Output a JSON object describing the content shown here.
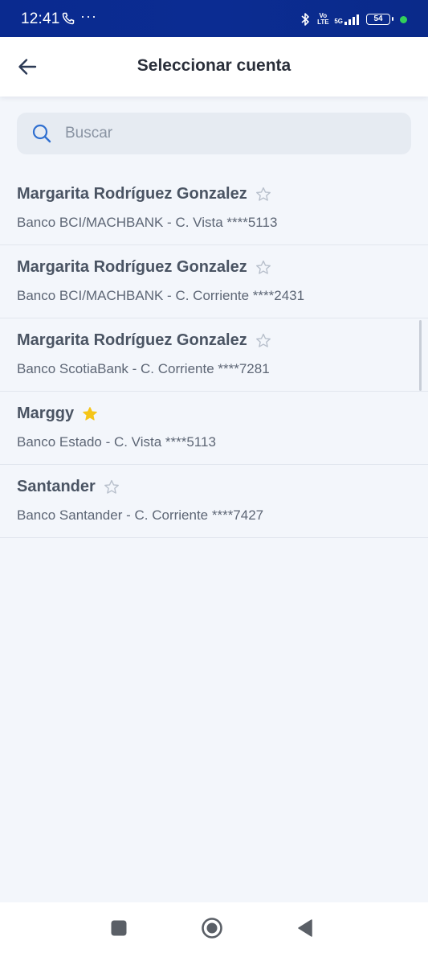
{
  "status_bar": {
    "time": "12:41",
    "volte_top": "Vo",
    "volte_bottom": "LTE",
    "network": "5G",
    "battery": "54"
  },
  "header": {
    "title": "Seleccionar cuenta"
  },
  "search": {
    "placeholder": "Buscar"
  },
  "accounts": [
    {
      "name": "Margarita Rodríguez Gonzalez",
      "detail": "Banco BCI/MACHBANK - C. Vista ****5113",
      "favorite": false
    },
    {
      "name": "Margarita Rodríguez Gonzalez",
      "detail": "Banco BCI/MACHBANK - C. Corriente ****2431",
      "favorite": false
    },
    {
      "name": "Margarita Rodríguez Gonzalez",
      "detail": "Banco ScotiaBank - C. Corriente ****7281",
      "favorite": false
    },
    {
      "name": "Marggy",
      "detail": "Banco Estado - C. Vista ****5113",
      "favorite": true
    },
    {
      "name": "Santander",
      "detail": "Banco Santander - C. Corriente ****7427",
      "favorite": false
    }
  ],
  "icons": {
    "back": "arrow-left-icon",
    "search": "search-icon",
    "favorite_on": "star-filled-icon",
    "favorite_off": "star-outline-icon",
    "nav_recents": "square-icon",
    "nav_home": "circle-icon",
    "nav_back": "triangle-back-icon"
  },
  "colors": {
    "status_bar": "#0b2c92",
    "star_filled": "#f5c518",
    "star_outline": "#b7bfcb",
    "accent": "#2f6fd0"
  }
}
